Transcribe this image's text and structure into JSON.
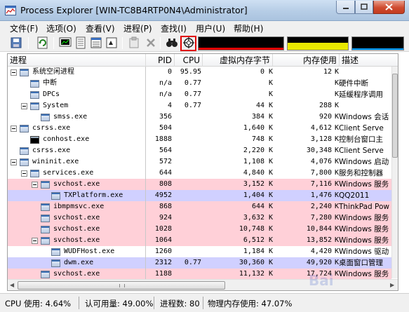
{
  "window": {
    "title": "Process Explorer [WIN-TC8B4RTP0N4\\Administrator]"
  },
  "menu": [
    "文件(F)",
    "选项(O)",
    "查看(V)",
    "进程(P)",
    "查找(I)",
    "用户(U)",
    "帮助(H)"
  ],
  "columns": {
    "process": "进程",
    "pid": "PID",
    "cpu": "CPU",
    "private_bytes": "虚拟内存字节",
    "working_set": "内存使用",
    "description": "描述"
  },
  "processes": [
    {
      "name": "系统空闲进程",
      "pid": "0",
      "cpu": "95.95",
      "private": "0",
      "private_unit": "K",
      "working": "12",
      "working_unit": "K",
      "desc": "",
      "color": "none"
    },
    {
      "name": "中断",
      "pid": "n/a",
      "cpu": "0.77",
      "private": "",
      "private_unit": "K",
      "working": "",
      "working_unit": "K",
      "desc": "硬件中断",
      "color": "none"
    },
    {
      "name": "DPCs",
      "pid": "n/a",
      "cpu": "0.77",
      "private": "",
      "private_unit": "K",
      "working": "",
      "working_unit": "K",
      "desc": "延缓程序调用",
      "color": "none"
    },
    {
      "name": "System",
      "pid": "4",
      "cpu": "0.77",
      "private": "44",
      "private_unit": "K",
      "working": "288",
      "working_unit": "K",
      "desc": "",
      "color": "none"
    },
    {
      "name": "smss.exe",
      "pid": "356",
      "cpu": "",
      "private": "384",
      "private_unit": "K",
      "working": "920",
      "working_unit": "K",
      "desc": "Windows 会话",
      "color": "none"
    },
    {
      "name": "csrss.exe",
      "pid": "504",
      "cpu": "",
      "private": "1,640",
      "private_unit": "K",
      "working": "4,612",
      "working_unit": "K",
      "desc": "Client Serve",
      "color": "none"
    },
    {
      "name": "conhost.exe",
      "pid": "1888",
      "cpu": "",
      "private": "748",
      "private_unit": "K",
      "working": "3,128",
      "working_unit": "K",
      "desc": "控制台窗口主",
      "color": "none"
    },
    {
      "name": "csrss.exe",
      "pid": "564",
      "cpu": "",
      "private": "2,220",
      "private_unit": "K",
      "working": "30,348",
      "working_unit": "K",
      "desc": "Client Serve",
      "color": "none"
    },
    {
      "name": "wininit.exe",
      "pid": "572",
      "cpu": "",
      "private": "1,108",
      "private_unit": "K",
      "working": "4,076",
      "working_unit": "K",
      "desc": "Windows 启动",
      "color": "none"
    },
    {
      "name": "services.exe",
      "pid": "644",
      "cpu": "",
      "private": "4,840",
      "private_unit": "K",
      "working": "7,800",
      "working_unit": "K",
      "desc": "服务和控制器",
      "color": "none"
    },
    {
      "name": "svchost.exe",
      "pid": "808",
      "cpu": "",
      "private": "3,152",
      "private_unit": "K",
      "working": "7,116",
      "working_unit": "K",
      "desc": "Windows 服务",
      "color": "pink"
    },
    {
      "name": "TXPlatform.exe",
      "pid": "4952",
      "cpu": "",
      "private": "1,404",
      "private_unit": "K",
      "working": "1,476",
      "working_unit": "K",
      "desc": "QQ2011",
      "color": "lav"
    },
    {
      "name": "ibmpmsvc.exe",
      "pid": "868",
      "cpu": "",
      "private": "644",
      "private_unit": "K",
      "working": "2,240",
      "working_unit": "K",
      "desc": "ThinkPad Pow",
      "color": "pink"
    },
    {
      "name": "svchost.exe",
      "pid": "924",
      "cpu": "",
      "private": "3,632",
      "private_unit": "K",
      "working": "7,280",
      "working_unit": "K",
      "desc": "Windows 服务",
      "color": "pink"
    },
    {
      "name": "svchost.exe",
      "pid": "1028",
      "cpu": "",
      "private": "10,748",
      "private_unit": "K",
      "working": "10,844",
      "working_unit": "K",
      "desc": "Windows 服务",
      "color": "pink"
    },
    {
      "name": "svchost.exe",
      "pid": "1064",
      "cpu": "",
      "private": "6,512",
      "private_unit": "K",
      "working": "13,852",
      "working_unit": "K",
      "desc": "Windows 服务",
      "color": "pink"
    },
    {
      "name": "WUDFHost.exe",
      "pid": "1260",
      "cpu": "",
      "private": "1,184",
      "private_unit": "K",
      "working": "4,420",
      "working_unit": "K",
      "desc": "Windows 驱动",
      "color": "none"
    },
    {
      "name": "dwm.exe",
      "pid": "2312",
      "cpu": "0.77",
      "private": "30,360",
      "private_unit": "K",
      "working": "49,920",
      "working_unit": "K",
      "desc": "桌面窗口管理",
      "color": "lav"
    },
    {
      "name": "svchost.exe",
      "pid": "1188",
      "cpu": "",
      "private": "11,132",
      "private_unit": "K",
      "working": "17,724",
      "working_unit": "K",
      "desc": "Windows 服务",
      "color": "pink"
    },
    {
      "name": "svchost.exe",
      "pid": "",
      "cpu": "",
      "private": "",
      "private_unit": "",
      "working": "",
      "working_unit": "",
      "desc": "",
      "color": "pink"
    }
  ],
  "status": {
    "cpu": "CPU 使用: 4.64%",
    "commit": "认可用量: 49.00%",
    "processes": "进程数: 80",
    "physical": "物理内存使用: 47.07%"
  },
  "graphs": {
    "cpu_color": "#e00000",
    "mem_color": "#e8e800",
    "io_color": "#00a0ff"
  },
  "colors": {
    "service_row": "#ffd0d8",
    "own_process_row": "#d0d0ff",
    "highlight_box": "#e00000"
  }
}
